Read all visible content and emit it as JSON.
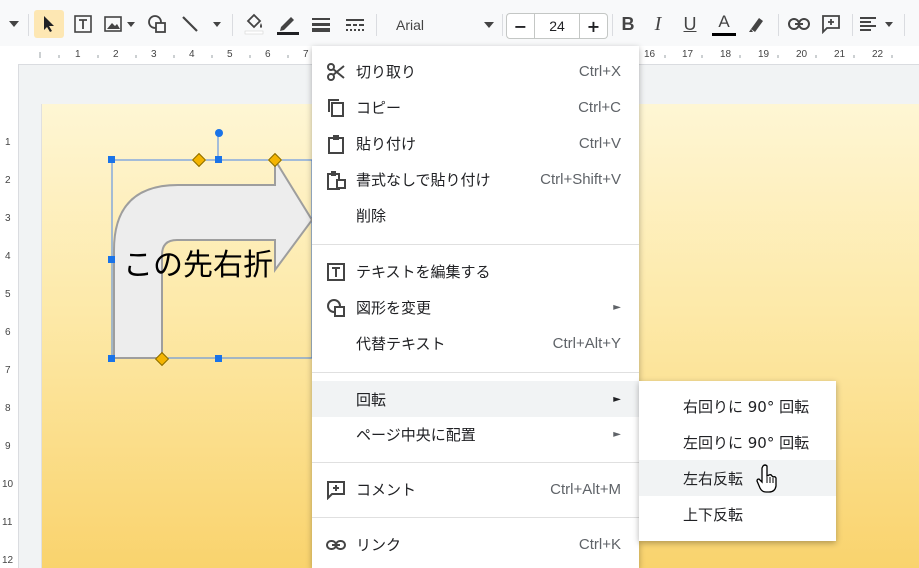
{
  "toolbar": {
    "font_name": "Arial",
    "font_size": "24",
    "bold_label": "B",
    "italic_label": "I",
    "underline_label": "U",
    "text_color_label": "A",
    "minus_label": "−",
    "plus_label": "+"
  },
  "ruler": {
    "h_numbers": [
      "1",
      "2",
      "3",
      "4",
      "5",
      "6",
      "7",
      "16",
      "17",
      "18",
      "19",
      "20",
      "21",
      "22"
    ],
    "v_numbers": [
      "1",
      "2",
      "3",
      "4",
      "5",
      "6",
      "7",
      "8",
      "9",
      "10",
      "11",
      "12"
    ]
  },
  "shape": {
    "text": "この先右折"
  },
  "menu": {
    "items": [
      {
        "label": "切り取り",
        "shortcut": "Ctrl+X",
        "icon": "scissors-icon"
      },
      {
        "label": "コピー",
        "shortcut": "Ctrl+C",
        "icon": "copy-icon"
      },
      {
        "label": "貼り付け",
        "shortcut": "Ctrl+V",
        "icon": "paste-icon"
      },
      {
        "label": "書式なしで貼り付け",
        "shortcut": "Ctrl+Shift+V",
        "icon": "paste-plain-icon"
      },
      {
        "label": "削除",
        "shortcut": ""
      },
      {
        "label": "テキストを編集する",
        "shortcut": "",
        "icon": "edit-text-icon"
      },
      {
        "label": "図形を変更",
        "arrow": "►",
        "icon": "shape-icon"
      },
      {
        "label": "代替テキスト",
        "shortcut": "Ctrl+Alt+Y"
      },
      {
        "label": "回転",
        "arrow": "►"
      },
      {
        "label": "ページ中央に配置",
        "arrow": "►"
      },
      {
        "label": "コメント",
        "shortcut": "Ctrl+Alt+M",
        "icon": "comment-icon"
      },
      {
        "label": "リンク",
        "shortcut": "Ctrl+K",
        "icon": "link-icon"
      }
    ]
  },
  "submenu": {
    "items": [
      {
        "label": "右回りに 90° 回転"
      },
      {
        "label": "左回りに 90° 回転"
      },
      {
        "label": "左右反転"
      },
      {
        "label": "上下反転"
      }
    ]
  },
  "colors": {
    "accent": "#1a73e8",
    "handle_yellow": "#f4b400"
  }
}
